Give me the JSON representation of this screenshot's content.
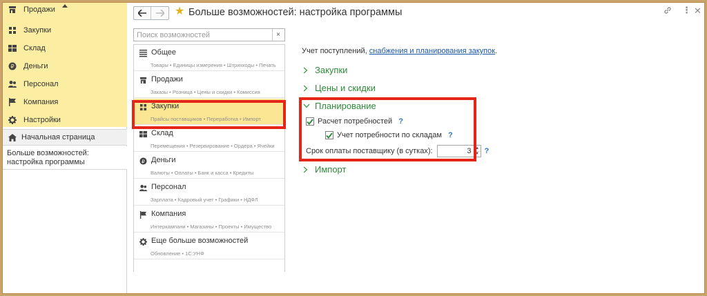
{
  "sections_panel": {
    "items": [
      {
        "label": "Продажи",
        "icon": "shop-icon"
      },
      {
        "label": "Закупки",
        "icon": "warehouse-cart-icon"
      },
      {
        "label": "Склад",
        "icon": "grid-icon"
      },
      {
        "label": "Деньги",
        "icon": "ruble-coin-icon"
      },
      {
        "label": "Персонал",
        "icon": "people-icon"
      },
      {
        "label": "Компания",
        "icon": "flag-icon"
      },
      {
        "label": "Настройки",
        "icon": "gear-icon"
      }
    ],
    "home_label": "Начальная страница",
    "open_window_label": "Больше возможностей: настройка программы"
  },
  "window": {
    "title": "Больше возможностей: настройка программы",
    "search_placeholder": "Поиск возможностей",
    "search_clear_label": "×"
  },
  "feature_list": [
    {
      "name": "Общее",
      "sub": "Товары • Единицы измерения • Штрихкоды • Печать",
      "icon": "list-lines-icon"
    },
    {
      "name": "Продажи",
      "sub": "Заказы • Розница • Цены и скидки • Комиссия",
      "icon": "shop-icon"
    },
    {
      "name": "Закупки",
      "sub": "Прайсы поставщиков • Переработка • Импорт",
      "icon": "warehouse-cart-icon",
      "selected": true
    },
    {
      "name": "Склад",
      "sub": "Перемещения • Резервирование • Ордера • Ячейки",
      "icon": "grid-icon"
    },
    {
      "name": "Деньги",
      "sub": "Валюты • Оплаты • Банк и касса • Кредиты",
      "icon": "ruble-coin-icon"
    },
    {
      "name": "Персонал",
      "sub": "Зарплата • Кадровый учет • Графики • НДФЛ",
      "icon": "people-icon"
    },
    {
      "name": "Компания",
      "sub": "Интеркампани • Магазины • Проекты • Имущество",
      "icon": "flag-icon"
    },
    {
      "name": "Еще больше возможностей",
      "sub": "Обновление • 1С:УНФ",
      "icon": "gear-icon"
    }
  ],
  "content": {
    "intro_text": "Учет поступлений, ",
    "intro_link": "снабжения и планирования закупок",
    "intro_end": ".",
    "groups": {
      "zakupki": "Закупки",
      "ceny": "Цены и скидки",
      "planirovanie": "Планирование",
      "import": "Импорт"
    },
    "checkbox_needs": {
      "label": "Расчет потребностей",
      "checked": true
    },
    "checkbox_warehouses": {
      "label": "Учет потребности по складам",
      "checked": true
    },
    "payment_term_label": "Срок оплаты поставщику (в сутках):",
    "payment_term_value": "3",
    "help_mark": "?"
  },
  "colors": {
    "sections_bg": "#fbeea3",
    "selected_item_bg": "#fbe793",
    "group_green": "#2e8b3a",
    "link_blue": "#1a56a7",
    "highlight_red": "#e5241a",
    "help_blue": "#2f76c7"
  }
}
